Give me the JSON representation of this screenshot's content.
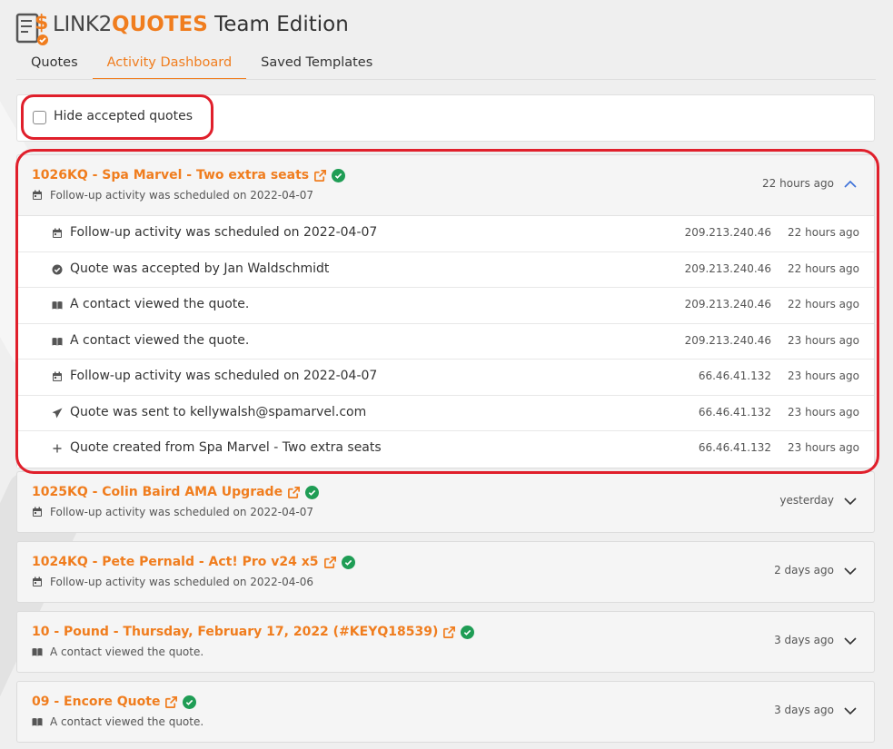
{
  "app": {
    "brand_part1": "LINK2",
    "brand_part2": "QUOTES",
    "brand_part3": " Team Edition"
  },
  "tabs": [
    {
      "label": "Quotes",
      "active": false
    },
    {
      "label": "Activity Dashboard",
      "active": true
    },
    {
      "label": "Saved Templates",
      "active": false
    }
  ],
  "filter": {
    "hide_accepted_label": "Hide accepted quotes",
    "checked": false
  },
  "colors": {
    "accent": "#f07d1e",
    "success": "#1f9d55",
    "highlight": "#e01f2b"
  },
  "quotes": [
    {
      "title": "1026KQ - Spa Marvel - Two extra seats",
      "subtitle": "Follow-up activity was scheduled on 2022-04-07",
      "subtitle_icon": "calendar-icon",
      "time": "22 hours ago",
      "expanded": true,
      "activities": [
        {
          "icon": "calendar-icon",
          "text": "Follow-up activity was scheduled on 2022-04-07",
          "ip": "209.213.240.46",
          "time": "22 hours ago"
        },
        {
          "icon": "check-circle-icon",
          "text": "Quote was accepted by Jan Waldschmidt",
          "ip": "209.213.240.46",
          "time": "22 hours ago"
        },
        {
          "icon": "book-open-icon",
          "text": "A contact viewed the quote.",
          "ip": "209.213.240.46",
          "time": "22 hours ago"
        },
        {
          "icon": "book-open-icon",
          "text": "A contact viewed the quote.",
          "ip": "209.213.240.46",
          "time": "23 hours ago"
        },
        {
          "icon": "calendar-icon",
          "text": "Follow-up activity was scheduled on 2022-04-07",
          "ip": "66.46.41.132",
          "time": "23 hours ago"
        },
        {
          "icon": "paper-plane-icon",
          "text": "Quote was sent to kellywalsh@spamarvel.com",
          "ip": "66.46.41.132",
          "time": "23 hours ago"
        },
        {
          "icon": "plus-icon",
          "text": "Quote created from Spa Marvel - Two extra seats",
          "ip": "66.46.41.132",
          "time": "23 hours ago"
        }
      ]
    },
    {
      "title": "1025KQ - Colin Baird AMA Upgrade",
      "subtitle": "Follow-up activity was scheduled on 2022-04-07",
      "subtitle_icon": "calendar-icon",
      "time": "yesterday",
      "expanded": false
    },
    {
      "title": "1024KQ - Pete Pernald - Act! Pro v24 x5",
      "subtitle": "Follow-up activity was scheduled on 2022-04-06",
      "subtitle_icon": "calendar-icon",
      "time": "2 days ago",
      "expanded": false
    },
    {
      "title": "10 - Pound - Thursday, February 17, 2022 (#KEYQ18539)",
      "subtitle": "A contact viewed the quote.",
      "subtitle_icon": "book-open-icon",
      "time": "3 days ago",
      "expanded": false
    },
    {
      "title": "09 - Encore Quote",
      "subtitle": "A contact viewed the quote.",
      "subtitle_icon": "book-open-icon",
      "time": "3 days ago",
      "expanded": false
    }
  ]
}
